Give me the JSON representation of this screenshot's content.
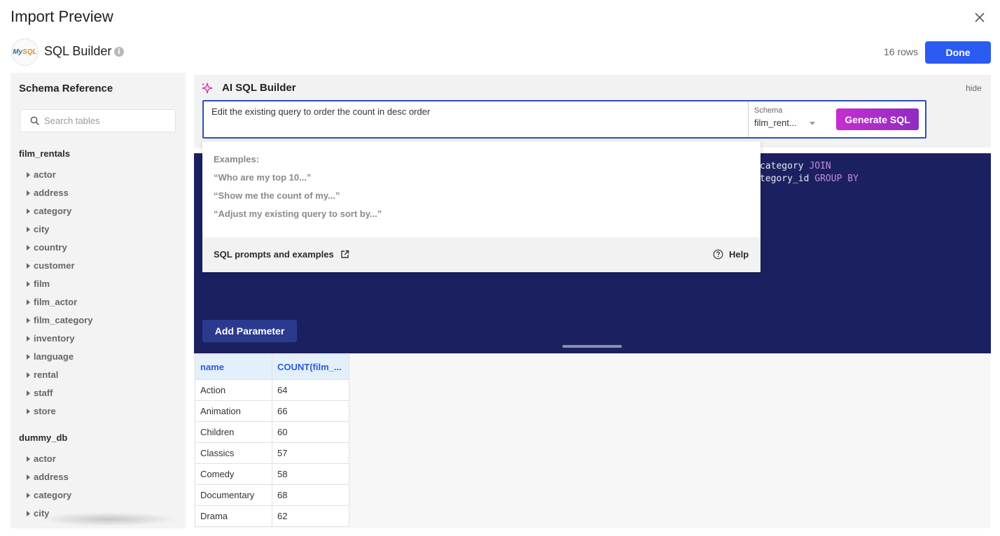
{
  "dialog": {
    "title": "Import Preview",
    "close_icon": "close-icon"
  },
  "toolbar": {
    "logo_text_a": "My",
    "logo_text_b": "SQL",
    "title": "SQL Builder",
    "info_icon": "i",
    "row_count": "16 rows",
    "done_label": "Done"
  },
  "sidebar": {
    "title": "Schema Reference",
    "search_placeholder": "Search tables",
    "databases": [
      {
        "name": "film_rentals",
        "tables": [
          "actor",
          "address",
          "category",
          "city",
          "country",
          "customer",
          "film",
          "film_actor",
          "film_category",
          "inventory",
          "language",
          "rental",
          "staff",
          "store"
        ]
      },
      {
        "name": "dummy_db",
        "tables": [
          "actor",
          "address",
          "category",
          "city"
        ]
      }
    ]
  },
  "ai_builder": {
    "title": "AI SQL Builder",
    "hide_label": "hide",
    "prompt_value": "Edit the existing query to order the count in desc order",
    "schema_label": "Schema",
    "schema_value": "film_rent...",
    "generate_label": "Generate SQL"
  },
  "editor": {
    "visible_line_1": {
      "text": "category ",
      "keyword": "JOIN"
    },
    "visible_line_2": {
      "text": "tegory_id ",
      "keyword": "GROUP BY"
    },
    "add_parameter_label": "Add Parameter"
  },
  "examples_dropdown": {
    "heading": "Examples:",
    "examples": [
      "“Who are my top 10...”",
      "“Show me the count of my...”",
      "“Adjust my existing query to sort by...”"
    ],
    "link_label": "SQL prompts and examples",
    "help_label": "Help"
  },
  "results": {
    "columns": [
      "name",
      "COUNT(film_..."
    ],
    "rows": [
      [
        "Action",
        "64"
      ],
      [
        "Animation",
        "66"
      ],
      [
        "Children",
        "60"
      ],
      [
        "Classics",
        "57"
      ],
      [
        "Comedy",
        "58"
      ],
      [
        "Documentary",
        "68"
      ],
      [
        "Drama",
        "62"
      ]
    ]
  },
  "colors": {
    "primary": "#2b5bf0",
    "editor_bg": "#1b2160",
    "generate_gradient_start": "#c52ed0",
    "generate_gradient_end": "#8f2cc2",
    "header_cell_bg": "#e3f0fb",
    "header_cell_text": "#2b5bd7"
  }
}
